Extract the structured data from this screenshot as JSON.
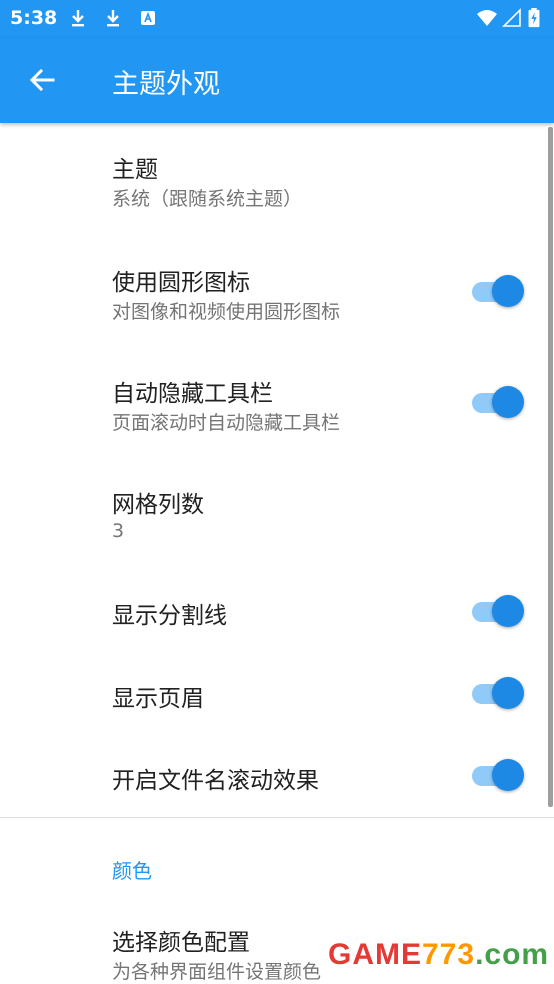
{
  "status_bar": {
    "time": "5:38",
    "icons": [
      "download-icon",
      "download-icon",
      "app-notification-icon",
      "wifi-icon",
      "signal-icon",
      "battery-charging-icon"
    ]
  },
  "app_bar": {
    "title": "主题外观",
    "back_icon": "arrow-back-icon",
    "color": "#2196f3"
  },
  "settings": {
    "theme": {
      "title": "主题",
      "summary": "系统（跟随系统主题）"
    },
    "circle_icons": {
      "title": "使用圆形图标",
      "summary": "对图像和视频使用圆形图标",
      "enabled": true
    },
    "auto_hide_toolbar": {
      "title": "自动隐藏工具栏",
      "summary": "页面滚动时自动隐藏工具栏",
      "enabled": true
    },
    "grid_columns": {
      "title": "网格列数",
      "summary": "3"
    },
    "show_dividers": {
      "title": "显示分割线",
      "enabled": true
    },
    "show_header": {
      "title": "显示页眉",
      "enabled": true
    },
    "filename_marquee": {
      "title": "开启文件名滚动效果",
      "enabled": true
    }
  },
  "color_section": {
    "header": "颜色",
    "choose_scheme": {
      "title": "选择颜色配置",
      "summary": "为各种界面组件设置颜色"
    }
  },
  "watermark": {
    "part1": "GAME",
    "part2": "773",
    "part3": ".com"
  },
  "colors": {
    "accent": "#1e88e5",
    "switch_track": "#90caf9",
    "section_header": "#2196f3"
  }
}
